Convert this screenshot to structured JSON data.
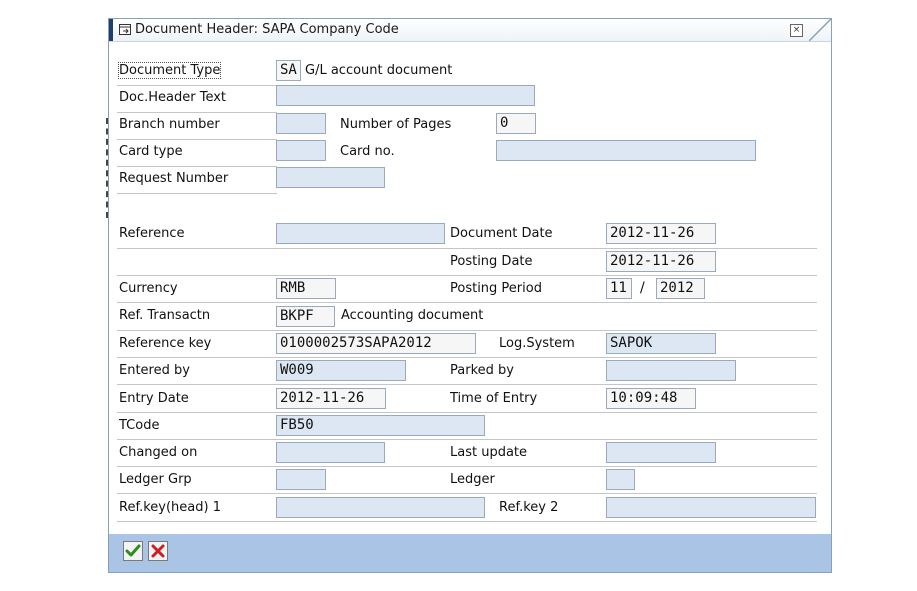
{
  "title": "Document Header: SAPA Company Code",
  "close_glyph": "×",
  "labels": {
    "document_type": "Document Type",
    "doc_header_text": "Doc.Header Text",
    "branch_number": "Branch number",
    "number_of_pages": "Number of Pages",
    "card_type": "Card type",
    "card_no": "Card no.",
    "request_number": "Request Number",
    "reference": "Reference",
    "document_date": "Document Date",
    "posting_date": "Posting Date",
    "currency": "Currency",
    "posting_period": "Posting Period",
    "ref_transactn": "Ref. Transactn",
    "reference_key": "Reference key",
    "log_system": "Log.System",
    "entered_by": "Entered by",
    "parked_by": "Parked by",
    "entry_date": "Entry Date",
    "time_of_entry": "Time of Entry",
    "tcode": "TCode",
    "changed_on": "Changed on",
    "last_update": "Last update",
    "ledger_grp": "Ledger Grp",
    "ledger": "Ledger",
    "ref_key_head_1": "Ref.key(head) 1",
    "ref_key_2": "Ref.key 2"
  },
  "values": {
    "document_type": "SA",
    "document_type_desc": "G/L account document",
    "doc_header_text": "",
    "branch_number": "",
    "number_of_pages": "0",
    "card_type": "",
    "card_no": "",
    "request_number": "",
    "reference": "",
    "document_date": "2012-11-26",
    "posting_date": "2012-11-26",
    "currency": "RMB",
    "posting_period": "11",
    "period_sep": "/",
    "posting_year": "2012",
    "ref_transactn": "BKPF",
    "ref_transactn_desc": "Accounting document",
    "reference_key": "0100002573SAPA2012",
    "log_system": "SAPOK",
    "entered_by": "W009",
    "parked_by": "",
    "entry_date": "2012-11-26",
    "time_of_entry": "10:09:48",
    "tcode": "FB50",
    "changed_on": "",
    "last_update": "",
    "ledger_grp": "",
    "ledger": "",
    "ref_key_head_1": "",
    "ref_key_2": ""
  },
  "footer": {
    "confirm_icon": "check-icon",
    "cancel_icon": "cancel-x-icon"
  },
  "colors": {
    "field_bg": "#dde7f3",
    "footer_bg": "#a9c4e4",
    "confirm_green": "#2e8b1e",
    "cancel_red": "#cc1f1f"
  }
}
